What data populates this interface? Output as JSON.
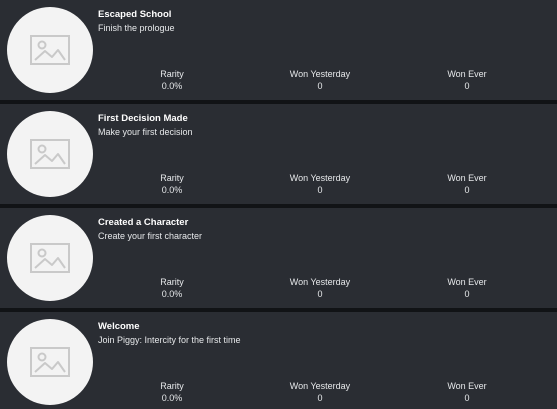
{
  "labels": {
    "rarity": "Rarity",
    "won_yesterday": "Won Yesterday",
    "won_ever": "Won Ever"
  },
  "thumbnail_icon": "image-placeholder-icon",
  "colors": {
    "card_background": "#2a2d33",
    "page_background": "#111316",
    "thumbnail_background": "#f3f3f3",
    "placeholder_icon": "#c9c9c9"
  },
  "badges": [
    {
      "title": "Escaped School",
      "description": "Finish the prologue",
      "rarity": "0.0%",
      "won_yesterday": "0",
      "won_ever": "0"
    },
    {
      "title": "First Decision Made",
      "description": "Make your first decision",
      "rarity": "0.0%",
      "won_yesterday": "0",
      "won_ever": "0"
    },
    {
      "title": "Created a Character",
      "description": "Create your first character",
      "rarity": "0.0%",
      "won_yesterday": "0",
      "won_ever": "0"
    },
    {
      "title": "Welcome",
      "description": "Join Piggy: Intercity for the first time",
      "rarity": "0.0%",
      "won_yesterday": "0",
      "won_ever": "0"
    }
  ]
}
